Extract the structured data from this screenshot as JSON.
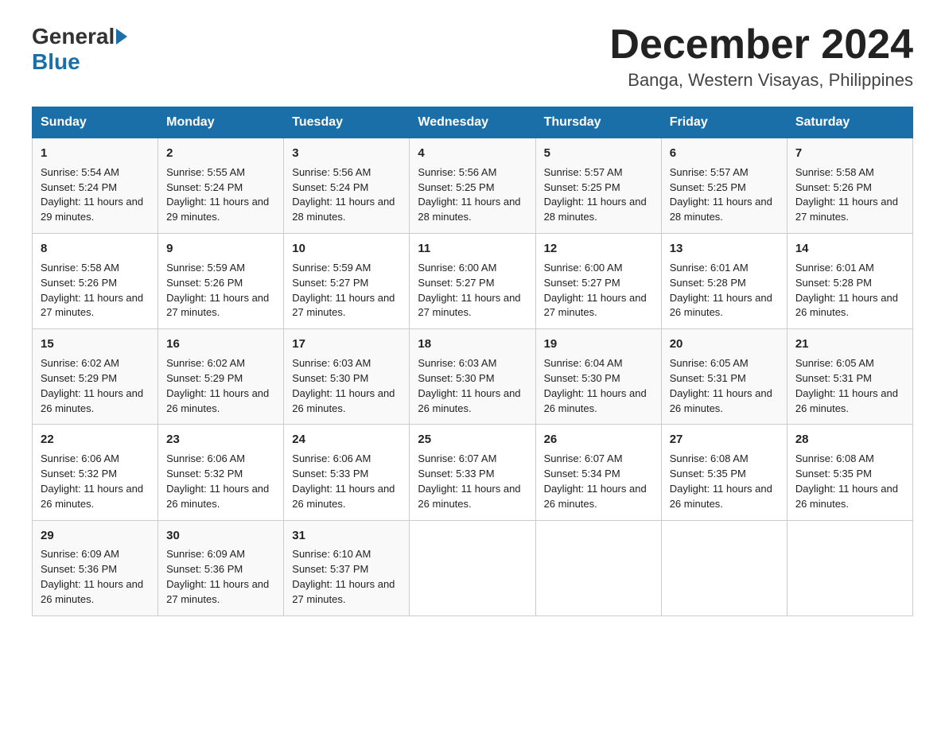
{
  "logo": {
    "general": "General",
    "blue": "Blue",
    "sub": "Blue"
  },
  "header": {
    "month_title": "December 2024",
    "location": "Banga, Western Visayas, Philippines"
  },
  "days_of_week": [
    "Sunday",
    "Monday",
    "Tuesday",
    "Wednesday",
    "Thursday",
    "Friday",
    "Saturday"
  ],
  "weeks": [
    [
      {
        "day": "1",
        "sunrise": "5:54 AM",
        "sunset": "5:24 PM",
        "daylight": "11 hours and 29 minutes."
      },
      {
        "day": "2",
        "sunrise": "5:55 AM",
        "sunset": "5:24 PM",
        "daylight": "11 hours and 29 minutes."
      },
      {
        "day": "3",
        "sunrise": "5:56 AM",
        "sunset": "5:24 PM",
        "daylight": "11 hours and 28 minutes."
      },
      {
        "day": "4",
        "sunrise": "5:56 AM",
        "sunset": "5:25 PM",
        "daylight": "11 hours and 28 minutes."
      },
      {
        "day": "5",
        "sunrise": "5:57 AM",
        "sunset": "5:25 PM",
        "daylight": "11 hours and 28 minutes."
      },
      {
        "day": "6",
        "sunrise": "5:57 AM",
        "sunset": "5:25 PM",
        "daylight": "11 hours and 28 minutes."
      },
      {
        "day": "7",
        "sunrise": "5:58 AM",
        "sunset": "5:26 PM",
        "daylight": "11 hours and 27 minutes."
      }
    ],
    [
      {
        "day": "8",
        "sunrise": "5:58 AM",
        "sunset": "5:26 PM",
        "daylight": "11 hours and 27 minutes."
      },
      {
        "day": "9",
        "sunrise": "5:59 AM",
        "sunset": "5:26 PM",
        "daylight": "11 hours and 27 minutes."
      },
      {
        "day": "10",
        "sunrise": "5:59 AM",
        "sunset": "5:27 PM",
        "daylight": "11 hours and 27 minutes."
      },
      {
        "day": "11",
        "sunrise": "6:00 AM",
        "sunset": "5:27 PM",
        "daylight": "11 hours and 27 minutes."
      },
      {
        "day": "12",
        "sunrise": "6:00 AM",
        "sunset": "5:27 PM",
        "daylight": "11 hours and 27 minutes."
      },
      {
        "day": "13",
        "sunrise": "6:01 AM",
        "sunset": "5:28 PM",
        "daylight": "11 hours and 26 minutes."
      },
      {
        "day": "14",
        "sunrise": "6:01 AM",
        "sunset": "5:28 PM",
        "daylight": "11 hours and 26 minutes."
      }
    ],
    [
      {
        "day": "15",
        "sunrise": "6:02 AM",
        "sunset": "5:29 PM",
        "daylight": "11 hours and 26 minutes."
      },
      {
        "day": "16",
        "sunrise": "6:02 AM",
        "sunset": "5:29 PM",
        "daylight": "11 hours and 26 minutes."
      },
      {
        "day": "17",
        "sunrise": "6:03 AM",
        "sunset": "5:30 PM",
        "daylight": "11 hours and 26 minutes."
      },
      {
        "day": "18",
        "sunrise": "6:03 AM",
        "sunset": "5:30 PM",
        "daylight": "11 hours and 26 minutes."
      },
      {
        "day": "19",
        "sunrise": "6:04 AM",
        "sunset": "5:30 PM",
        "daylight": "11 hours and 26 minutes."
      },
      {
        "day": "20",
        "sunrise": "6:05 AM",
        "sunset": "5:31 PM",
        "daylight": "11 hours and 26 minutes."
      },
      {
        "day": "21",
        "sunrise": "6:05 AM",
        "sunset": "5:31 PM",
        "daylight": "11 hours and 26 minutes."
      }
    ],
    [
      {
        "day": "22",
        "sunrise": "6:06 AM",
        "sunset": "5:32 PM",
        "daylight": "11 hours and 26 minutes."
      },
      {
        "day": "23",
        "sunrise": "6:06 AM",
        "sunset": "5:32 PM",
        "daylight": "11 hours and 26 minutes."
      },
      {
        "day": "24",
        "sunrise": "6:06 AM",
        "sunset": "5:33 PM",
        "daylight": "11 hours and 26 minutes."
      },
      {
        "day": "25",
        "sunrise": "6:07 AM",
        "sunset": "5:33 PM",
        "daylight": "11 hours and 26 minutes."
      },
      {
        "day": "26",
        "sunrise": "6:07 AM",
        "sunset": "5:34 PM",
        "daylight": "11 hours and 26 minutes."
      },
      {
        "day": "27",
        "sunrise": "6:08 AM",
        "sunset": "5:35 PM",
        "daylight": "11 hours and 26 minutes."
      },
      {
        "day": "28",
        "sunrise": "6:08 AM",
        "sunset": "5:35 PM",
        "daylight": "11 hours and 26 minutes."
      }
    ],
    [
      {
        "day": "29",
        "sunrise": "6:09 AM",
        "sunset": "5:36 PM",
        "daylight": "11 hours and 26 minutes."
      },
      {
        "day": "30",
        "sunrise": "6:09 AM",
        "sunset": "5:36 PM",
        "daylight": "11 hours and 27 minutes."
      },
      {
        "day": "31",
        "sunrise": "6:10 AM",
        "sunset": "5:37 PM",
        "daylight": "11 hours and 27 minutes."
      },
      null,
      null,
      null,
      null
    ]
  ]
}
